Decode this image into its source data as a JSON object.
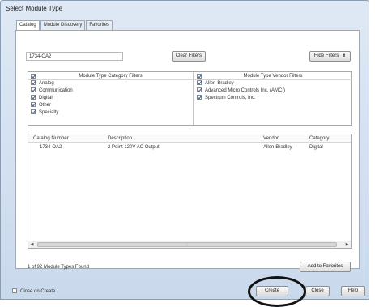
{
  "window": {
    "title": "Select Module Type"
  },
  "tabs": [
    "Catalog",
    "Module Discovery",
    "Favorites"
  ],
  "search": {
    "value": "1734-OA2"
  },
  "buttons": {
    "clear_filters": "Clear Filters",
    "hide_filters": "Hide Filters",
    "hide_filters_icon": "⬆",
    "add_to_favorites": "Add to Favorites",
    "create": "Create",
    "close": "Close",
    "help": "Help"
  },
  "category_filters": {
    "header": "Module Type Category Filters",
    "items": [
      {
        "label": "Analog",
        "checked": true
      },
      {
        "label": "Communication",
        "checked": true
      },
      {
        "label": "Digital",
        "checked": true
      },
      {
        "label": "Other",
        "checked": true
      },
      {
        "label": "Specialty",
        "checked": true
      }
    ]
  },
  "vendor_filters": {
    "header": "Module Type Vendor Filters",
    "items": [
      {
        "label": "Allen-Bradley",
        "checked": true
      },
      {
        "label": "Advanced Micro Controls Inc. (AMCI)",
        "checked": true
      },
      {
        "label": "Spectrum Controls, Inc.",
        "checked": true
      }
    ]
  },
  "table": {
    "columns": [
      "Catalog Number",
      "Description",
      "Vendor",
      "Category"
    ],
    "rows": [
      {
        "catalog": "1734-OA2",
        "description": "2 Point 120V AC Output",
        "vendor": "Allen-Bradley",
        "category": "Digital"
      }
    ]
  },
  "status": {
    "text": "1 of 92 Module Types Found"
  },
  "close_on_create": {
    "label": "Close on Create",
    "checked": false
  },
  "colors": {
    "window_frame": "#c9d9ec",
    "accent": "#2d5b94",
    "highlight_circle": "#111111"
  }
}
